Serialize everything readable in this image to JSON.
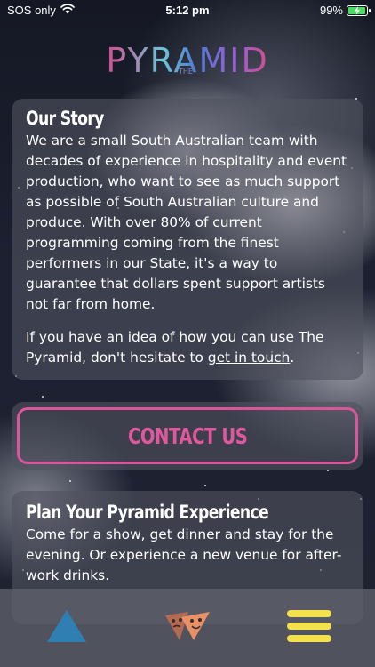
{
  "status": {
    "carrier": "SOS only",
    "time": "5:12 pm",
    "battery": "99%",
    "battery_level": 0.99,
    "wifi_icon": "wifi-icon",
    "battery_icon": "battery-charging-icon"
  },
  "logo": {
    "main": "PYRAMID",
    "small": "THE"
  },
  "story": {
    "title": "Our Story",
    "paragraph1": "We are a small South Australian team with decades of experience in hospitality and event production, who want to see as much support as possible of South Australian culture and produce. With over 80% of current programming coming from the finest performers in our State, it's a way to guarantee that dollars spent support artists not far from home.",
    "paragraph2_prefix": "If you have an idea of how you can use The Pyramid, don't hesitate to ",
    "paragraph2_link": "get in touch",
    "paragraph2_suffix": "."
  },
  "contact": {
    "label": "CONTACT US"
  },
  "plan": {
    "title": "Plan Your Pyramid Experience",
    "body": "Come for a show, get dinner and stay for the evening. Or experience a new venue for after-work drinks."
  },
  "nav": {
    "items": [
      {
        "name": "home",
        "icon": "triangle-icon",
        "color": "#2f7fb3"
      },
      {
        "name": "shows",
        "icon": "masks-icon",
        "color": "#e08a66"
      },
      {
        "name": "menu",
        "icon": "hamburger-menu-icon",
        "color": "#f4e04d"
      }
    ]
  },
  "colors": {
    "accent_pink": "#e0579d",
    "card_bg": "#50525f"
  }
}
